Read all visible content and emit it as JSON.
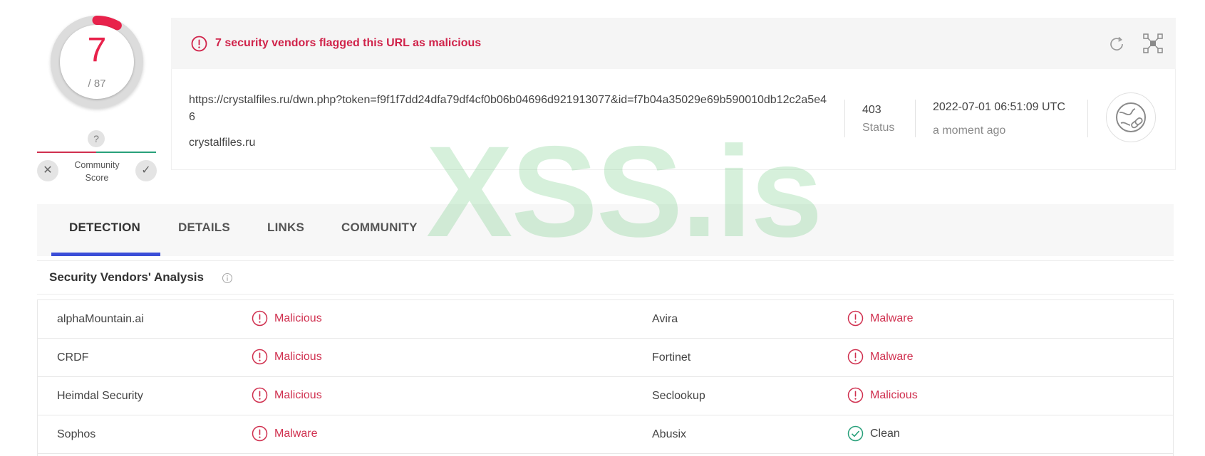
{
  "score": {
    "detections": "7",
    "total": "/ 87",
    "accent": "#e8224b",
    "fraction": 0.0805
  },
  "community": {
    "question": "?",
    "label_line1": "Community",
    "label_line2": "Score",
    "dislike_symbol": "✕",
    "like_symbol": "✓"
  },
  "banner": {
    "message": "7 security vendors flagged this URL as malicious",
    "icon": "alert-circle-icon"
  },
  "toolbar": {
    "reanalyze_icon": "refresh-icon",
    "graph_icon": "graph-icon"
  },
  "url_info": {
    "url": "https://crystalfiles.ru/dwn.php?token=f9f1f7dd24dfa79df4cf0b06b04696d921913077&id=f7b04a35029e69b590010db12c2a5e46",
    "domain": "crystalfiles.ru",
    "status_code": "403",
    "status_label": "Status",
    "date": "2022-07-01 06:51:09 UTC",
    "relative_time": "a moment ago",
    "type_icon": "globe-link-icon"
  },
  "tabs": [
    {
      "label": "DETECTION",
      "active": true
    },
    {
      "label": "DETAILS",
      "active": false
    },
    {
      "label": "LINKS",
      "active": false
    },
    {
      "label": "COMMUNITY",
      "active": false
    }
  ],
  "section": {
    "title": "Security Vendors' Analysis",
    "info_icon": "info-icon"
  },
  "vendors": [
    {
      "left_name": "alphaMountain.ai",
      "left_result": "Malicious",
      "left_status": "malicious",
      "right_name": "Avira",
      "right_result": "Malware",
      "right_status": "malicious"
    },
    {
      "left_name": "CRDF",
      "left_result": "Malicious",
      "left_status": "malicious",
      "right_name": "Fortinet",
      "right_result": "Malware",
      "right_status": "malicious"
    },
    {
      "left_name": "Heimdal Security",
      "left_result": "Malicious",
      "left_status": "malicious",
      "right_name": "Seclookup",
      "right_result": "Malicious",
      "right_status": "malicious"
    },
    {
      "left_name": "Sophos",
      "left_result": "Malware",
      "left_status": "malicious",
      "right_name": "Abusix",
      "right_result": "Clean",
      "right_status": "clean"
    }
  ],
  "watermark": "XSS.is",
  "colors": {
    "malicious": "#d0304f",
    "clean": "#28a07a",
    "tab_accent": "#3b4ed8"
  }
}
